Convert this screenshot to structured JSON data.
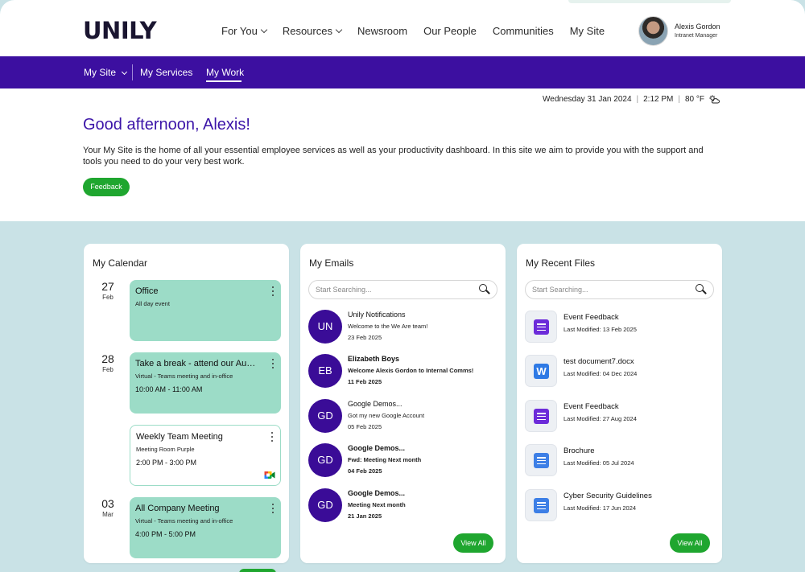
{
  "header": {
    "logo": "UNILY",
    "nav": [
      "For You",
      "Resources",
      "Newsroom",
      "Our People",
      "Communities",
      "My Site"
    ],
    "user": {
      "name": "Alexis Gordon",
      "role": "Intranet Manager"
    }
  },
  "subnav": {
    "items": [
      "My Site",
      "My Services",
      "My Work"
    ],
    "active": "My Work"
  },
  "intro": {
    "date": "Wednesday 31 Jan 2024",
    "time": "2:12 PM",
    "temperature": "80 °F",
    "greeting": "Good afternoon, Alexis!",
    "text": "Your My Site is the home of all your essential employee services as well as your productivity dashboard. In this site we aim to provide you with the support and tools you need to do your very best work.",
    "feedback_label": "Feedback"
  },
  "calendar": {
    "title": "My Calendar",
    "dates": [
      {
        "day": "27",
        "month": "Feb"
      },
      {
        "day": "28",
        "month": "Feb"
      },
      {
        "day": "03",
        "month": "Mar"
      }
    ],
    "events": [
      {
        "title": "Office",
        "subtitle": "All day event",
        "time": ""
      },
      {
        "title": "Take a break - attend our August Meetup",
        "subtitle": "Virtual - Teams meeting and in-office",
        "time": "10:00 AM - 11:00 AM"
      },
      {
        "title": "Weekly Team Meeting",
        "subtitle": "Meeting Room Purple",
        "time": "2:00 PM - 3:00 PM"
      },
      {
        "title": "All Company Meeting",
        "subtitle": "Virtual - Teams meeting and in-office",
        "time": "4:00 PM - 5:00 PM"
      }
    ]
  },
  "emails": {
    "title": "My Emails",
    "search_placeholder": "Start Searching...",
    "items": [
      {
        "initials": "UN",
        "from": "Unily Notifications",
        "subject": "Welcome to the We Are team!",
        "date": "23 Feb 2025",
        "unread": false
      },
      {
        "initials": "EB",
        "from": "Elizabeth Boys",
        "subject": "Welcome Alexis Gordon to Internal Comms!",
        "date": "11 Feb 2025",
        "unread": true
      },
      {
        "initials": "GD",
        "from": "Google Demos...",
        "subject": "Got my new Google Account",
        "date": "05 Feb 2025",
        "unread": false
      },
      {
        "initials": "GD",
        "from": "Google Demos...",
        "subject": "Fwd: Meeting Next month",
        "date": "04 Feb 2025",
        "unread": true
      },
      {
        "initials": "GD",
        "from": "Google Demos...",
        "subject": "Meeting Next month",
        "date": "21 Jan 2025",
        "unread": true
      }
    ],
    "view_all": "View All"
  },
  "files": {
    "title": "My Recent Files",
    "search_placeholder": "Start Searching...",
    "items": [
      {
        "name": "Event Feedback",
        "modified": "Last Modified: 13 Feb 2025",
        "icon": "forms-icon"
      },
      {
        "name": "test document7.docx",
        "modified": "Last Modified: 04 Dec 2024",
        "icon": "word-icon",
        "glyph": "W"
      },
      {
        "name": "Event Feedback",
        "modified": "Last Modified: 27 Aug 2024",
        "icon": "forms-icon"
      },
      {
        "name": "Brochure",
        "modified": "Last Modified: 05 Jul 2024",
        "icon": "docs-icon"
      },
      {
        "name": "Cyber Security Guidelines",
        "modified": "Last Modified: 17 Jun 2024",
        "icon": "docs-icon"
      }
    ],
    "view_all": "View All"
  },
  "colors": {
    "brand_purple": "#3c0fa0",
    "accent_green": "#1fa62f",
    "event_green": "#9cdcc7",
    "page_bg": "#c9e2e6"
  }
}
